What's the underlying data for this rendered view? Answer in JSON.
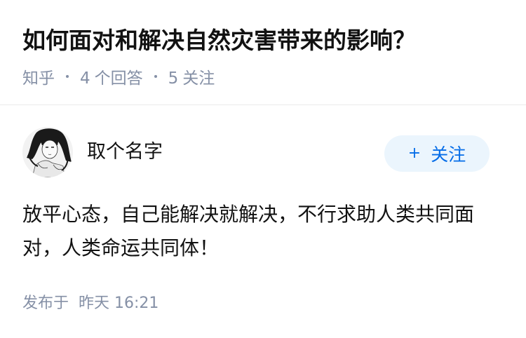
{
  "question": {
    "title": "如何面对和解决自然灾害带来的影响？",
    "source": "知乎",
    "answer_count": "4",
    "answer_label": "个回答",
    "follow_count": "5",
    "follow_label": "关注"
  },
  "answer": {
    "author_name": "取个名字",
    "follow_button": "关注",
    "follow_button_icon": "+",
    "content": "放平心态，自己能解决就解决，不行求助人类共同面对，人类命运共同体！",
    "published_label": "发布于",
    "published_time": "昨天 16:21"
  },
  "colors": {
    "text_primary": "#121212",
    "text_secondary": "#8590a6",
    "accent": "#056de8",
    "follow_bg": "#ebf5fd"
  }
}
